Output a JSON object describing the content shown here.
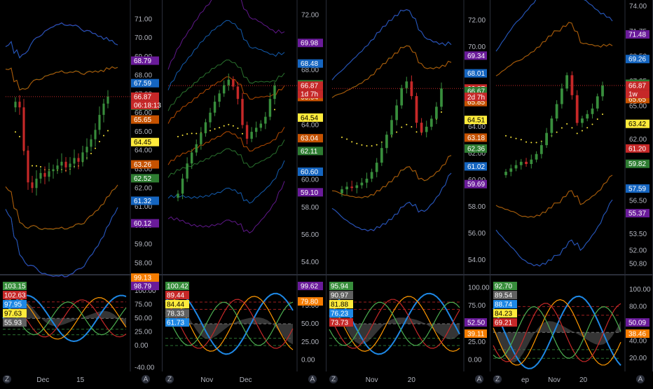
{
  "chart_data": [
    {
      "type": "line",
      "panel": "top-1",
      "price_ticks": [
        "71.00",
        "70.00",
        "69.00",
        "68.00",
        "67.00",
        "66.00",
        "65.00",
        "64.00",
        "63.00",
        "62.00",
        "61.00",
        "60.00",
        "59.00",
        "58.00"
      ],
      "ylim": [
        57.6,
        71.8
      ],
      "time_labels": [
        "Dec",
        "15"
      ],
      "last_price": 66.87,
      "countdown": "06:18:13",
      "tags": [
        {
          "text": "68.79",
          "value": 68.79,
          "color": "#6a1b9a"
        },
        {
          "text": "67.59",
          "value": 67.59,
          "color": "#1565c0"
        },
        {
          "text": "66.87",
          "value": 66.87,
          "color": "#c62828"
        },
        {
          "text": "66.39",
          "value": 66.39,
          "color": "#2e7d32"
        },
        {
          "text": "65.65",
          "value": 65.65,
          "color": "#c65200"
        },
        {
          "text": "64.45",
          "value": 64.45,
          "color": "#ffeb3b"
        },
        {
          "text": "63.26",
          "value": 63.26,
          "color": "#c65200"
        },
        {
          "text": "62.52",
          "value": 62.52,
          "color": "#2e7d32"
        },
        {
          "text": "61.32",
          "value": 61.32,
          "color": "#1565c0"
        },
        {
          "text": "60.12",
          "value": 60.12,
          "color": "#6a1b9a"
        }
      ],
      "closes": [
        66.6,
        66.3,
        64.0,
        62.3,
        62.0,
        62.5,
        62.8,
        62.6,
        62.9,
        63.0,
        63.2,
        63.4,
        63.1,
        63.3,
        63.6,
        63.4,
        63.9,
        64.2,
        64.6,
        65.1,
        65.9,
        66.5,
        66.87
      ]
    },
    {
      "type": "line",
      "panel": "top-2",
      "price_ticks": [
        "72.00",
        "70.00",
        "68.00",
        "66.00",
        "64.00",
        "62.00",
        "60.00",
        "58.00",
        "56.00",
        "54.00"
      ],
      "ylim": [
        53.4,
        72.8
      ],
      "time_labels": [
        "Nov",
        "Dec"
      ],
      "last_price": 66.87,
      "countdown": "1d 7h",
      "tags": [
        {
          "text": "69.98",
          "value": 69.98,
          "color": "#6a1b9a"
        },
        {
          "text": "68.48",
          "value": 68.48,
          "color": "#1565c0"
        },
        {
          "text": "66.97",
          "value": 66.97,
          "color": "#2e7d32"
        },
        {
          "text": "66.87",
          "value": 66.87,
          "color": "#c62828"
        },
        {
          "text": "66.04",
          "value": 66.04,
          "color": "#c65200"
        },
        {
          "text": "64.54",
          "value": 64.54,
          "color": "#ffeb3b"
        },
        {
          "text": "63.04",
          "value": 63.04,
          "color": "#c65200"
        },
        {
          "text": "62.11",
          "value": 62.11,
          "color": "#2e7d32"
        },
        {
          "text": "60.60",
          "value": 60.6,
          "color": "#1565c0"
        },
        {
          "text": "59.10",
          "value": 59.1,
          "color": "#6a1b9a"
        }
      ],
      "closes": [
        59.0,
        60.1,
        61.2,
        62.0,
        62.6,
        63.4,
        64.2,
        64.9,
        65.7,
        66.3,
        66.9,
        67.3,
        66.8,
        65.9,
        64.0,
        63.0,
        63.5,
        63.8,
        64.1,
        64.6,
        65.9,
        66.87
      ]
    },
    {
      "type": "line",
      "panel": "top-3",
      "price_ticks": [
        "72.00",
        "70.00",
        "68.00",
        "66.00",
        "64.00",
        "62.00",
        "60.00",
        "58.00",
        "56.00",
        "54.00"
      ],
      "ylim": [
        53.2,
        73.2
      ],
      "time_labels": [
        "Nov",
        "20"
      ],
      "last_price": 66.87,
      "countdown": "2d 7h",
      "tags": [
        {
          "text": "69.34",
          "value": 69.34,
          "color": "#6a1b9a"
        },
        {
          "text": "68.01",
          "value": 68.01,
          "color": "#1565c0"
        },
        {
          "text": "66.87",
          "value": 66.87,
          "color": "#c62828"
        },
        {
          "text": "66.67",
          "value": 66.67,
          "color": "#2e7d32"
        },
        {
          "text": "65.85",
          "value": 65.85,
          "color": "#c65200"
        },
        {
          "text": "64.51",
          "value": 64.51,
          "color": "#ffeb3b"
        },
        {
          "text": "63.18",
          "value": 63.18,
          "color": "#c65200"
        },
        {
          "text": "62.36",
          "value": 62.36,
          "color": "#2e7d32"
        },
        {
          "text": "61.02",
          "value": 61.02,
          "color": "#1565c0"
        },
        {
          "text": "59.69",
          "value": 59.69,
          "color": "#6a1b9a"
        }
      ],
      "closes": [
        59.3,
        59.5,
        59.4,
        59.6,
        59.8,
        60.1,
        60.6,
        61.3,
        62.4,
        63.4,
        64.5,
        65.6,
        66.9,
        67.4,
        66.3,
        64.3,
        63.6,
        64.0,
        64.6,
        65.5,
        66.87
      ]
    },
    {
      "type": "line",
      "panel": "top-4",
      "price_ticks": [
        "74.00",
        "71.75",
        "69.50",
        "67.25",
        "65.00",
        "62.00",
        "59.82",
        "57.59",
        "56.50",
        "53.50",
        "52.00",
        "50.80"
      ],
      "ylim": [
        50.2,
        74.2
      ],
      "time_labels": [
        "ep",
        "Nov",
        "20"
      ],
      "last_price": 66.87,
      "countdown": "1w",
      "tags": [
        {
          "text": "71.48",
          "value": 71.48,
          "color": "#6a1b9a"
        },
        {
          "text": "69.26",
          "value": 69.26,
          "color": "#1565c0"
        },
        {
          "text": "67.03",
          "value": 67.03,
          "color": "#2e7d32"
        },
        {
          "text": "66.87",
          "value": 66.87,
          "color": "#c62828"
        },
        {
          "text": "65.65",
          "value": 65.65,
          "color": "#c65200"
        },
        {
          "text": "63.42",
          "value": 63.42,
          "color": "#ffeb3b"
        },
        {
          "text": "61.20",
          "value": 61.2,
          "color": "#c62828"
        },
        {
          "text": "59.82",
          "value": 59.82,
          "color": "#2e7d32"
        },
        {
          "text": "57.59",
          "value": 57.59,
          "color": "#1565c0"
        },
        {
          "text": "55.37",
          "value": 55.37,
          "color": "#6a1b9a"
        }
      ],
      "closes": [
        59.1,
        59.4,
        59.7,
        60.0,
        59.8,
        60.2,
        60.7,
        61.5,
        62.6,
        63.9,
        65.2,
        66.6,
        67.8,
        66.0,
        63.5,
        63.9,
        64.3,
        64.8,
        65.9,
        66.87
      ]
    }
  ],
  "osc": [
    {
      "panel": "bottom-1",
      "ticks": [
        "120.00",
        "100.00",
        "75.00",
        "50.00",
        "25.00",
        "0.00",
        "-40.00"
      ],
      "ylim": [
        -42,
        122
      ],
      "time_labels": [
        "Dec",
        "15"
      ],
      "left_tags": [
        {
          "text": "103.15",
          "color": "#388e3c"
        },
        {
          "text": "102.63",
          "color": "#c62828"
        },
        {
          "text": "97.95",
          "color": "#1e88e5"
        },
        {
          "text": "97.63",
          "color": "#ffeb3b"
        },
        {
          "text": "55.93",
          "color": "#616161"
        }
      ],
      "right_tags": [
        {
          "text": "99.13",
          "color": "#f57c00"
        },
        {
          "text": "98.79",
          "color": "#6a1b9a"
        }
      ]
    },
    {
      "panel": "bottom-2",
      "ticks": [
        "100.00",
        "75.00",
        "50.00",
        "25.00",
        "0.00"
      ],
      "ylim": [
        -12,
        112
      ],
      "time_labels": [
        "Nov",
        "Dec"
      ],
      "left_tags": [
        {
          "text": "100.42",
          "color": "#388e3c"
        },
        {
          "text": "89.44",
          "color": "#c62828"
        },
        {
          "text": "84.44",
          "color": "#ffeb3b"
        },
        {
          "text": "78.33",
          "color": "#616161"
        },
        {
          "text": "61.73",
          "color": "#1e88e5"
        }
      ],
      "right_tags": [
        {
          "text": "99.62",
          "color": "#6a1b9a"
        },
        {
          "text": "79.80",
          "color": "#f57c00"
        }
      ]
    },
    {
      "panel": "bottom-3",
      "ticks": [
        "100.00",
        "75.00",
        "50.00",
        "25.00",
        "0.00"
      ],
      "ylim": [
        -12,
        112
      ],
      "time_labels": [
        "Nov",
        "20"
      ],
      "left_tags": [
        {
          "text": "95.94",
          "color": "#388e3c"
        },
        {
          "text": "90.97",
          "color": "#616161"
        },
        {
          "text": "81.88",
          "color": "#ffeb3b"
        },
        {
          "text": "76.23",
          "color": "#1e88e5"
        },
        {
          "text": "73.73",
          "color": "#c62828"
        }
      ],
      "right_tags": [
        {
          "text": "52.50",
          "color": "#6a1b9a"
        },
        {
          "text": "39.11",
          "color": "#f57c00"
        }
      ]
    },
    {
      "panel": "bottom-4",
      "ticks": [
        "100.00",
        "80.00",
        "60.00",
        "40.00",
        "20.00"
      ],
      "ylim": [
        8,
        112
      ],
      "time_labels": [
        "ep",
        "Nov",
        "20"
      ],
      "left_tags": [
        {
          "text": "92.70",
          "color": "#388e3c"
        },
        {
          "text": "89.54",
          "color": "#616161"
        },
        {
          "text": "88.74",
          "color": "#1e88e5"
        },
        {
          "text": "84.23",
          "color": "#ffeb3b"
        },
        {
          "text": "69.21",
          "color": "#c62828"
        }
      ],
      "right_tags": [
        {
          "text": "50.09",
          "color": "#6a1b9a"
        },
        {
          "text": "38.46",
          "color": "#f57c00"
        }
      ]
    }
  ],
  "buttons": {
    "left": "Z",
    "right": "A"
  },
  "colors": {
    "bg": "#000000",
    "grid": "#1e222d",
    "up": "#388e3c",
    "down": "#c62828",
    "divider": "#2a2e39"
  }
}
